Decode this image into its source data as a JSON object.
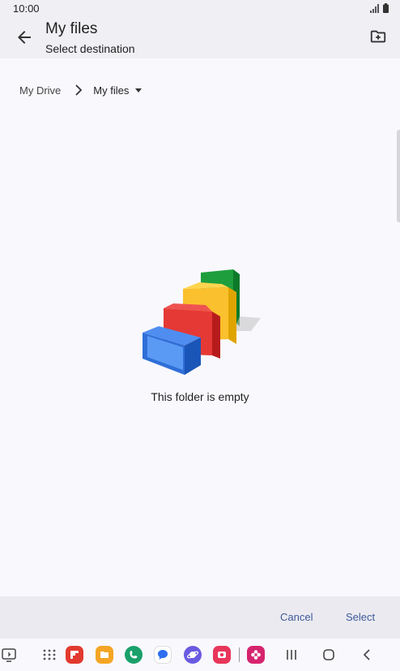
{
  "status_bar": {
    "time": "10:00"
  },
  "app_bar": {
    "title": "My files",
    "subtitle": "Select destination"
  },
  "breadcrumb": {
    "root": "My Drive",
    "current": "My files"
  },
  "empty_state": {
    "message": "This folder is empty"
  },
  "actions": {
    "cancel": "Cancel",
    "select": "Select"
  },
  "nav_apps": [
    {
      "name": "Flipboard",
      "color": "#e23a2e"
    },
    {
      "name": "My Files",
      "color": "#f5a524"
    },
    {
      "name": "Phone",
      "color": "#1aa06a"
    },
    {
      "name": "Messages",
      "color": "#2d6ff0"
    },
    {
      "name": "Internet",
      "color": "#6a5ae0"
    },
    {
      "name": "Screen Recorder",
      "color": "#e8365a"
    },
    {
      "name": "Blossom",
      "color": "#d6246e"
    }
  ]
}
